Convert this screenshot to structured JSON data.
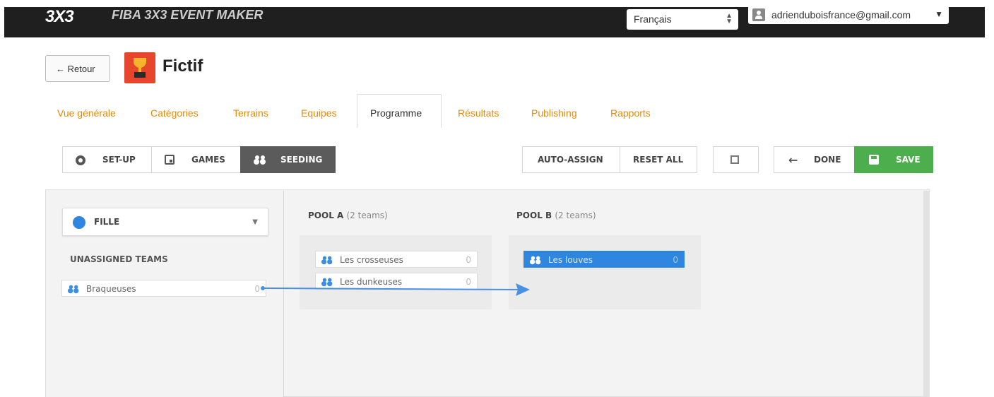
{
  "header": {
    "logo": "3X3",
    "app_title": "FIBA 3X3 EVENT MAKER",
    "language": "Français",
    "user_email": "adrienduboisfrance@gmail.com",
    "back_label": "← Retour",
    "event_name": "Fictif"
  },
  "tabs": [
    {
      "label": "Vue générale",
      "active": false
    },
    {
      "label": "Catégories",
      "active": false
    },
    {
      "label": "Terrains",
      "active": false
    },
    {
      "label": "Equipes",
      "active": false
    },
    {
      "label": "Programme",
      "active": true
    },
    {
      "label": "Résultats",
      "active": false
    },
    {
      "label": "Publishing",
      "active": false
    },
    {
      "label": "Rapports",
      "active": false
    }
  ],
  "toolbar": {
    "setup_label": "SET-UP",
    "games_label": "GAMES",
    "seeding_label": "SEEDING",
    "auto_assign_label": "AUTO-ASSIGN",
    "reset_all_label": "RESET ALL",
    "done_label": "DONE",
    "save_label": "SAVE"
  },
  "category": {
    "selected": "FILLE",
    "color": "#2e86de"
  },
  "unassigned": {
    "title": "UNASSIGNED TEAMS",
    "teams": [
      {
        "name": "Braqueuses",
        "count": "0"
      }
    ]
  },
  "pools": [
    {
      "name": "POOL A",
      "subtitle": "(2 teams)",
      "teams": [
        {
          "name": "Les crosseuses",
          "count": "0"
        },
        {
          "name": "Les dunkeuses",
          "count": "0"
        }
      ]
    },
    {
      "name": "POOL B",
      "subtitle": "(2 teams)",
      "teams": [
        {
          "name": "Les louves",
          "count": "0",
          "selected": true
        }
      ]
    }
  ],
  "colors": {
    "topbar": "#1f1f1f",
    "tab_link": "#e88a00",
    "accent_blue": "#2e86de",
    "save_green": "#4cae4c",
    "seeding_active": "#5b5b5b"
  }
}
